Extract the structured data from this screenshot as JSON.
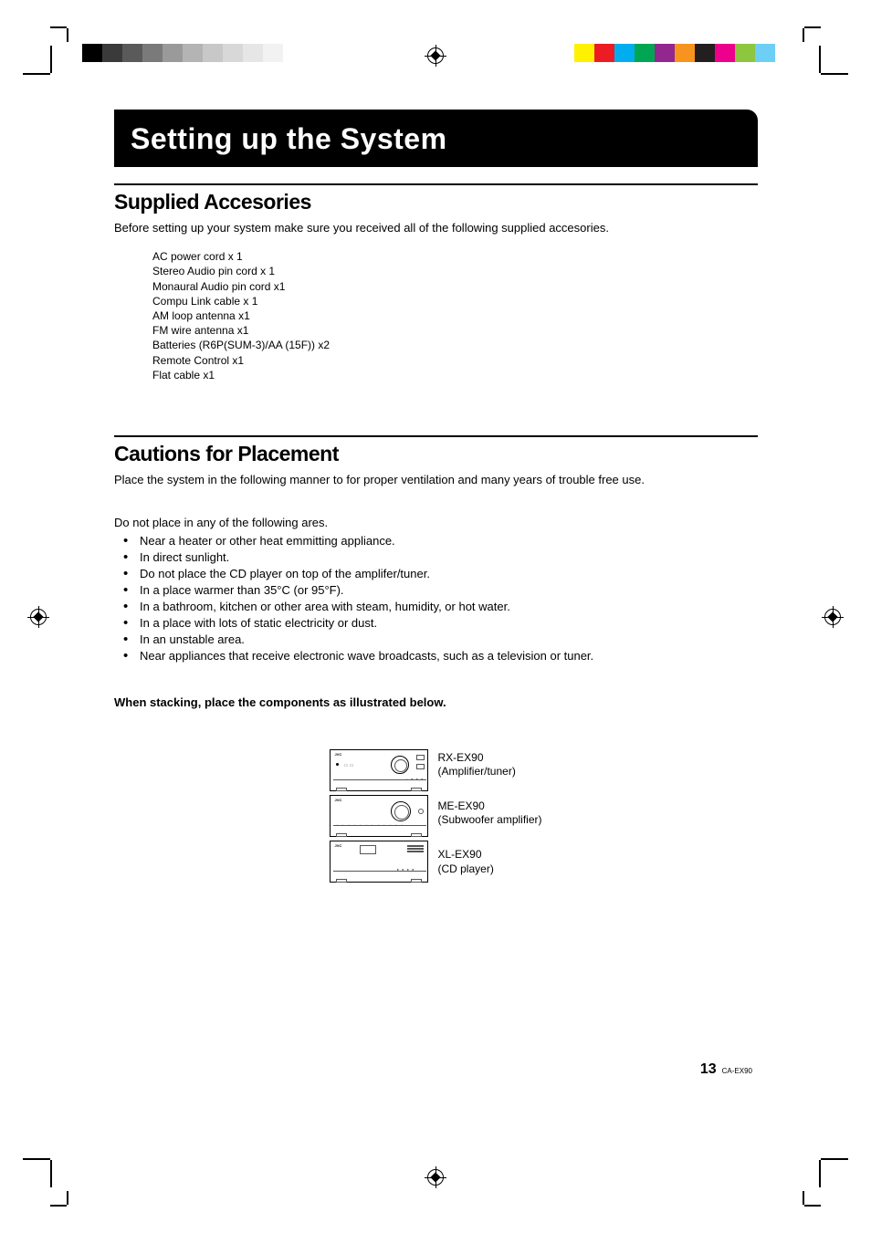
{
  "colorbar_left": [
    "#000000",
    "#3a3a3a",
    "#5a5a5a",
    "#7a7a7a",
    "#9a9a9a",
    "#b4b4b4",
    "#c8c8c8",
    "#d8d8d8",
    "#e6e6e6",
    "#f2f2f2"
  ],
  "colorbar_right": [
    "#fff200",
    "#ed1c24",
    "#00aeef",
    "#00a651",
    "#92278f",
    "#f7941d",
    "#231f20",
    "#ec008c",
    "#8dc63f",
    "#6dcff6"
  ],
  "chapter_title": "Setting up the System",
  "section1": {
    "heading": "Supplied Accesories",
    "intro": "Before setting up your system make sure you received all of the following supplied accesories.",
    "items": [
      "AC power cord x 1",
      "Stereo Audio pin cord  x 1",
      "Monaural Audio pin cord x1",
      "Compu Link cable x 1",
      "AM loop antenna x1",
      "FM wire antenna x1",
      "Batteries (R6P(SUM-3)/AA (15F)) x2",
      "Remote Control x1",
      "Flat cable x1"
    ]
  },
  "section2": {
    "heading": "Cautions for Placement",
    "intro": "Place the system in the following manner to for proper ventilation and many years of trouble free use.",
    "subintro": "Do not place in any of the following ares.",
    "bullets": [
      "Near a heater or other heat emmitting appliance.",
      "In direct sunlight.",
      "Do not place the CD player on top of the amplifer/tuner.",
      "In a place warmer than 35°C (or 95°F).",
      "In a bathroom, kitchen or other area with steam, humidity, or hot water.",
      "In a place with lots of static electricity or dust.",
      "In an unstable area.",
      "Near appliances that receive electronic wave broadcasts, such as a television or tuner."
    ],
    "stacking_note": "When stacking, place the components as illustrated below.",
    "components": [
      {
        "model": "RX-EX90",
        "desc": "(Amplifier/tuner)"
      },
      {
        "model": "ME-EX90",
        "desc": "(Subwoofer amplifier)"
      },
      {
        "model": "XL-EX90",
        "desc": "(CD player)"
      }
    ]
  },
  "footer": {
    "page": "13",
    "doc": "CA-EX90"
  }
}
